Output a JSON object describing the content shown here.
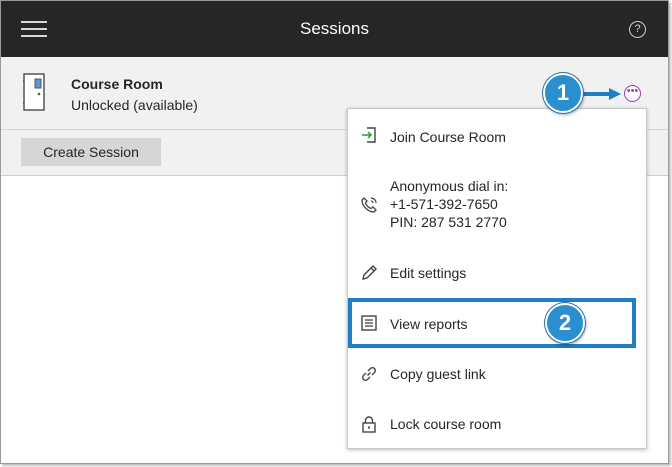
{
  "header": {
    "title": "Sessions",
    "menu_icon": "hamburger-icon",
    "help_icon": "help-icon",
    "help_glyph": "?"
  },
  "room": {
    "name": "Course Room",
    "status": "Unlocked (available)",
    "icon": "door-icon"
  },
  "toolbar": {
    "create_label": "Create Session"
  },
  "more_button": {
    "glyph": "•••",
    "color": "#9b3fb8"
  },
  "menu": {
    "items": [
      {
        "label": "Join Course Room",
        "icon": "enter-icon"
      },
      {
        "label": "Anonymous dial in:",
        "phone": "+1-571-392-7650",
        "pin": "PIN: 287 531 2770",
        "icon": "phone-icon"
      },
      {
        "label": "Edit settings",
        "icon": "pencil-icon"
      },
      {
        "label": "View reports",
        "icon": "report-icon"
      },
      {
        "label": "Copy guest link",
        "icon": "link-icon"
      },
      {
        "label": "Lock course room",
        "icon": "lock-icon"
      }
    ]
  },
  "annotations": {
    "step1": "1",
    "step2": "2",
    "accent": "#1f7fc4",
    "badge_color": "#2a8fd1"
  }
}
